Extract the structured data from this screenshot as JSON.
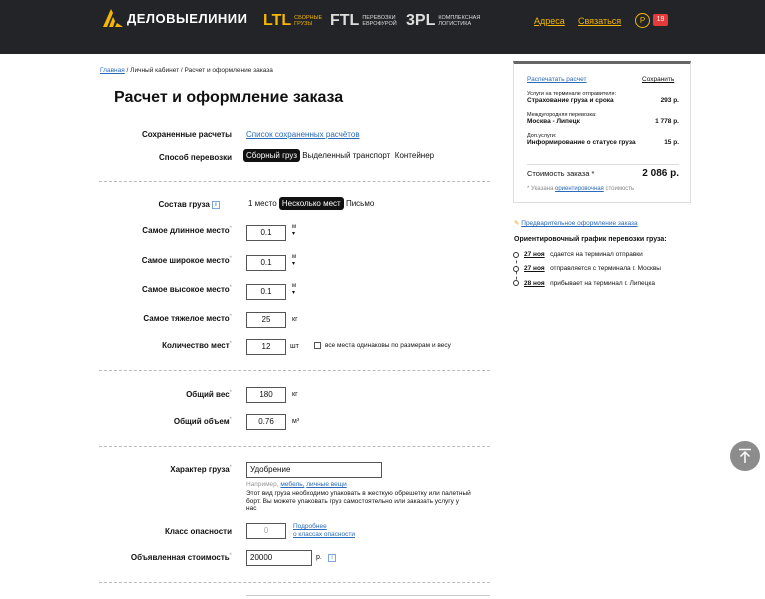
{
  "header": {
    "logo_text": "ДЕЛОВЫЕЛИНИИ",
    "services": [
      {
        "code": "LTL",
        "desc1": "сборные",
        "desc2": "грузы"
      },
      {
        "code": "FTL",
        "desc1": "перевозки",
        "desc2": "еврофурой"
      },
      {
        "code": "3PL",
        "desc1": "комплексная",
        "desc2": "логистика"
      }
    ],
    "links": {
      "addresses": "Адреса",
      "contact": "Связаться"
    },
    "currency": "Р",
    "badge": "19"
  },
  "breadcrumbs": [
    "Главная",
    "Личный кабинет",
    "Расчет и оформление заказа"
  ],
  "title": "Расчет и оформление заказа",
  "saved": {
    "label": "Сохраненные расчеты",
    "link": "Список сохраненных расчётов"
  },
  "transport": {
    "label": "Способ перевозки",
    "options": [
      "Сборный груз",
      "Выделенный транспорт",
      "Контейнер"
    ]
  },
  "composition": {
    "label": "Состав груза",
    "options": [
      "1 место",
      "Несколько мест",
      "Письмо"
    ]
  },
  "fields": {
    "length": {
      "label": "Самое длинное место",
      "value": "0.1",
      "unit": "м"
    },
    "width": {
      "label": "Самое широкое место",
      "value": "0.1",
      "unit": "м"
    },
    "height": {
      "label": "Самое высокое место",
      "value": "0.1",
      "unit": "м"
    },
    "weight": {
      "label": "Самое тяжелое место",
      "value": "25",
      "unit": "кг"
    },
    "count": {
      "label": "Количество мест",
      "value": "12",
      "unit": "шт",
      "checkbox": "все места одинаковы по размерам и весу"
    },
    "total_weight": {
      "label": "Общий вес",
      "value": "180",
      "unit": "кг"
    },
    "total_volume": {
      "label": "Общий объем",
      "value": "0.76",
      "unit": "м³"
    },
    "character": {
      "label": "Характер груза",
      "value": "Удобрение",
      "hint_prefix": "Например,",
      "hint_link1": "мебель,",
      "hint_link2": "личные вещи",
      "note": "Этот вид груза необходимо упаковать в жесткую обрешетку или палетный борт. Вы можете упаковать груз самостоятельно или заказать услугу у нас"
    },
    "danger": {
      "label": "Класс опасности",
      "value": "0",
      "link1": "Подробнее",
      "link2": "о классах опасности"
    },
    "declared": {
      "label": "Объявленная стоимость",
      "value": "20000",
      "unit": "р."
    }
  },
  "summary": {
    "print": "Распечатать расчет",
    "save": "Сохранить",
    "rows": [
      {
        "title": "Услуги на терминале отправителя:",
        "name": "Страхование груза и срока",
        "price": "293 р."
      },
      {
        "title": "Междугородняя перевозка:",
        "name": "Москва - Липецк",
        "price": "1 778 р."
      },
      {
        "title": "Доп.услуги:",
        "name": "Информирование о статусе груза",
        "price": "15 р."
      }
    ],
    "total_label": "Стоимость заказа *",
    "total": "2 086 р.",
    "footnote_prefix": "* Указана",
    "footnote_link": "ориентировочная",
    "footnote_suffix": "стоимость"
  },
  "preorder": "Предварительное оформление заказа",
  "schedule": {
    "title": "Ориентировочный график перевозки груза:",
    "items": [
      {
        "date": "27 ноя",
        "text": "сдается на терминал отправки"
      },
      {
        "date": "27 ноя",
        "text": "отправляется с терминала г. Москвы"
      },
      {
        "date": "28 ноя",
        "text": "прибывает на терминал г. Липецка"
      }
    ]
  },
  "colors": {
    "accent": "#f5b700",
    "header_bg": "#222428",
    "link": "#2a6ab8",
    "badge": "#e53a3a"
  }
}
